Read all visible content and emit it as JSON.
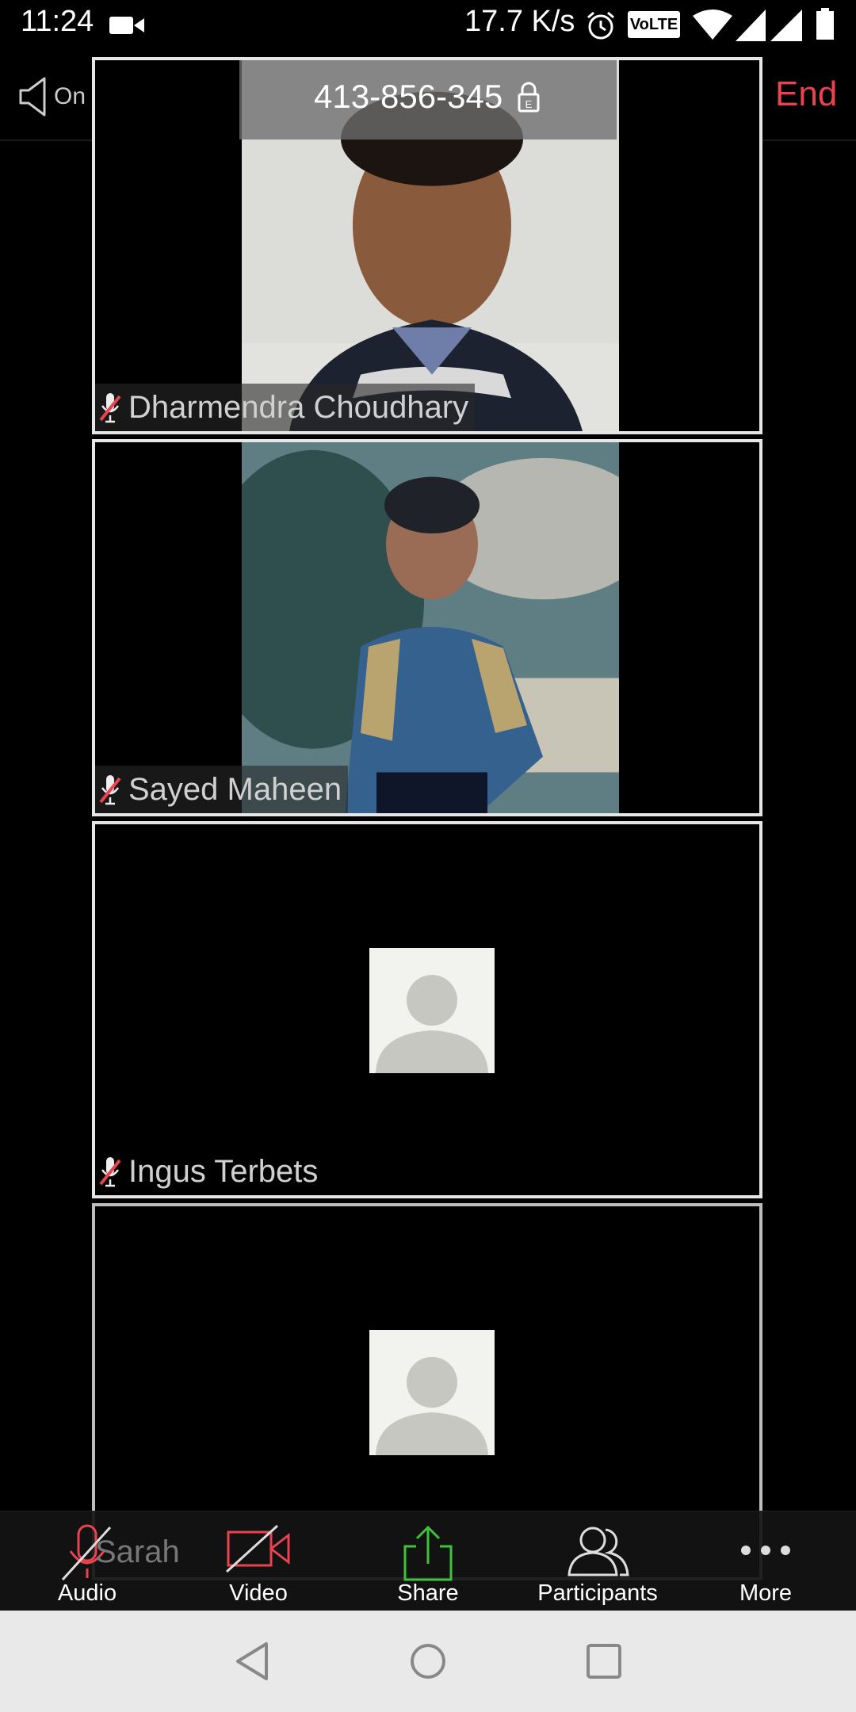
{
  "status_bar": {
    "time": "11:24",
    "network_speed": "17.7 K/s",
    "volte": "VoLTE",
    "icons": [
      "video-camera-icon",
      "alarm-icon",
      "volte-icon",
      "wifi-icon",
      "signal-icon",
      "battery-icon"
    ]
  },
  "meeting": {
    "speaker_label": "On",
    "meeting_id": "413-856-345",
    "end_label": "End",
    "accent_color": "#e8434f"
  },
  "participants": [
    {
      "name": "Dharmendra Choudhary",
      "muted": true,
      "video": true
    },
    {
      "name": "Sayed Maheen",
      "muted": true,
      "video": true
    },
    {
      "name": "Ingus Terbets",
      "muted": true,
      "video": false
    },
    {
      "name": "Sarah",
      "muted": true,
      "video": false
    }
  ],
  "toolbar": {
    "audio": "Audio",
    "video": "Video",
    "share": "Share",
    "participants": "Participants",
    "more": "More",
    "share_color": "#3fc13a"
  },
  "navbar": {
    "icons": [
      "back-icon",
      "home-icon",
      "recents-icon"
    ]
  }
}
